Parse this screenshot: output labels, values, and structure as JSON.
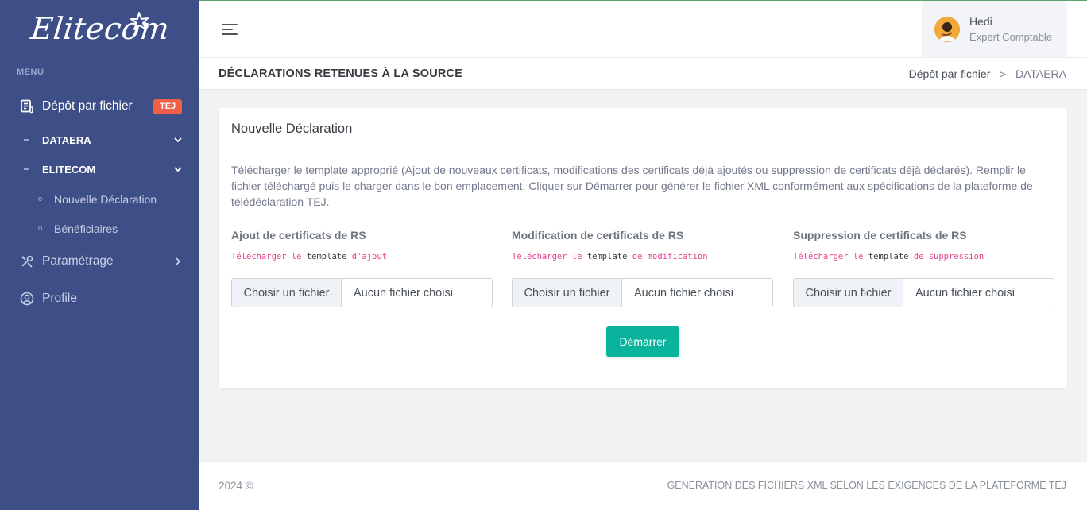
{
  "sidebar": {
    "logo_text": "Elitecom",
    "menu_title": "MENU",
    "items": [
      {
        "label": "Dépôt par fichier",
        "badge": "TEJ",
        "icon": "document-icon"
      },
      {
        "label": "DATAERA",
        "icon": "chevron-down-icon"
      },
      {
        "label": "ELITECOM",
        "icon": "chevron-down-icon"
      },
      {
        "label": "Nouvelle Déclaration"
      },
      {
        "label": "Bénéficiaires"
      },
      {
        "label": "Paramétrage",
        "icon": "tools-icon"
      },
      {
        "label": "Profile",
        "icon": "user-circle-icon"
      }
    ]
  },
  "header": {
    "user_name": "Hedi",
    "user_role": "Expert Comptable"
  },
  "titlebar": {
    "title": "DÉCLARATIONS RETENUES À LA SOURCE",
    "breadcrumb": [
      "Dépôt par fichier",
      "DATAERA"
    ],
    "separator": ">"
  },
  "card": {
    "title": "Nouvelle Déclaration",
    "description": "Télécharger le template approprié (Ajout de nouveaux certificats, modifications des certificats déjà ajoutés ou suppression de certificats déjà déclarés). Remplir le fichier téléchargé puis le charger dans le bon emplacement. Cliquer sur Démarrer pour générer le fichier XML conformément aux spécifications de la plateforme de télédéclaration TEJ.",
    "columns": [
      {
        "label": "Ajout de certificats de RS",
        "link_a": "Télécharger le",
        "link_b": "template",
        "link_c": "d'ajout",
        "button": "Choisir un fichier",
        "file": "Aucun fichier choisi"
      },
      {
        "label": "Modification de certificats de RS",
        "link_a": "Télécharger le",
        "link_b": "template",
        "link_c": "de modification",
        "button": "Choisir un fichier",
        "file": "Aucun fichier choisi"
      },
      {
        "label": "Suppression de certificats de RS",
        "link_a": "Télécharger le",
        "link_b": "template",
        "link_c": "de suppression",
        "button": "Choisir un fichier",
        "file": "Aucun fichier choisi"
      }
    ],
    "start_label": "Démarrer"
  },
  "footer": {
    "copyright": "2024 ©",
    "tagline": "GENERATION DES FICHIERS XML SELON LES EXIGENCES DE LA PLATEFORME TEJ"
  },
  "colors": {
    "sidebar": "#3e4e86",
    "badge": "#f05f48",
    "primary_button": "#0ab39c",
    "link": "#e83e8c"
  }
}
